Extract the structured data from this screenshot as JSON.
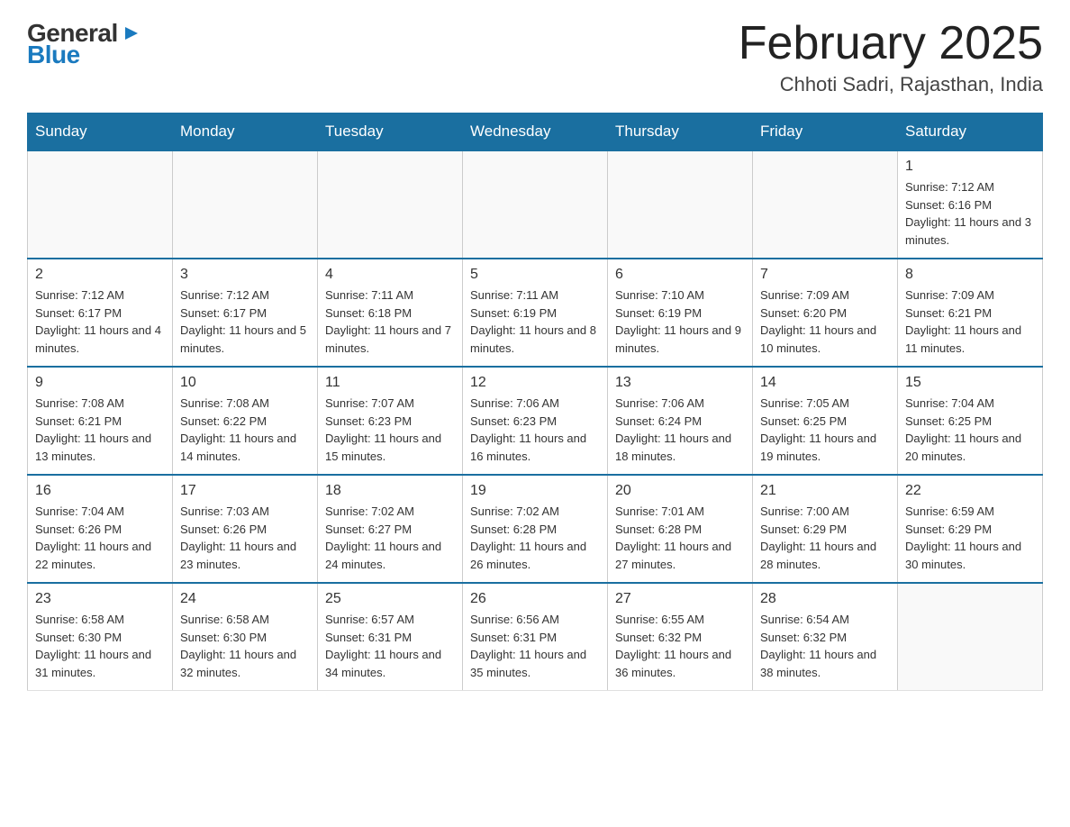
{
  "logo": {
    "general": "General",
    "blue": "Blue",
    "arrow": "▶"
  },
  "title": "February 2025",
  "location": "Chhoti Sadri, Rajasthan, India",
  "days_of_week": [
    "Sunday",
    "Monday",
    "Tuesday",
    "Wednesday",
    "Thursday",
    "Friday",
    "Saturday"
  ],
  "weeks": [
    [
      {
        "day": "",
        "info": ""
      },
      {
        "day": "",
        "info": ""
      },
      {
        "day": "",
        "info": ""
      },
      {
        "day": "",
        "info": ""
      },
      {
        "day": "",
        "info": ""
      },
      {
        "day": "",
        "info": ""
      },
      {
        "day": "1",
        "info": "Sunrise: 7:12 AM\nSunset: 6:16 PM\nDaylight: 11 hours\nand 3 minutes."
      }
    ],
    [
      {
        "day": "2",
        "info": "Sunrise: 7:12 AM\nSunset: 6:17 PM\nDaylight: 11 hours\nand 4 minutes."
      },
      {
        "day": "3",
        "info": "Sunrise: 7:12 AM\nSunset: 6:17 PM\nDaylight: 11 hours\nand 5 minutes."
      },
      {
        "day": "4",
        "info": "Sunrise: 7:11 AM\nSunset: 6:18 PM\nDaylight: 11 hours\nand 7 minutes."
      },
      {
        "day": "5",
        "info": "Sunrise: 7:11 AM\nSunset: 6:19 PM\nDaylight: 11 hours\nand 8 minutes."
      },
      {
        "day": "6",
        "info": "Sunrise: 7:10 AM\nSunset: 6:19 PM\nDaylight: 11 hours\nand 9 minutes."
      },
      {
        "day": "7",
        "info": "Sunrise: 7:09 AM\nSunset: 6:20 PM\nDaylight: 11 hours\nand 10 minutes."
      },
      {
        "day": "8",
        "info": "Sunrise: 7:09 AM\nSunset: 6:21 PM\nDaylight: 11 hours\nand 11 minutes."
      }
    ],
    [
      {
        "day": "9",
        "info": "Sunrise: 7:08 AM\nSunset: 6:21 PM\nDaylight: 11 hours\nand 13 minutes."
      },
      {
        "day": "10",
        "info": "Sunrise: 7:08 AM\nSunset: 6:22 PM\nDaylight: 11 hours\nand 14 minutes."
      },
      {
        "day": "11",
        "info": "Sunrise: 7:07 AM\nSunset: 6:23 PM\nDaylight: 11 hours\nand 15 minutes."
      },
      {
        "day": "12",
        "info": "Sunrise: 7:06 AM\nSunset: 6:23 PM\nDaylight: 11 hours\nand 16 minutes."
      },
      {
        "day": "13",
        "info": "Sunrise: 7:06 AM\nSunset: 6:24 PM\nDaylight: 11 hours\nand 18 minutes."
      },
      {
        "day": "14",
        "info": "Sunrise: 7:05 AM\nSunset: 6:25 PM\nDaylight: 11 hours\nand 19 minutes."
      },
      {
        "day": "15",
        "info": "Sunrise: 7:04 AM\nSunset: 6:25 PM\nDaylight: 11 hours\nand 20 minutes."
      }
    ],
    [
      {
        "day": "16",
        "info": "Sunrise: 7:04 AM\nSunset: 6:26 PM\nDaylight: 11 hours\nand 22 minutes."
      },
      {
        "day": "17",
        "info": "Sunrise: 7:03 AM\nSunset: 6:26 PM\nDaylight: 11 hours\nand 23 minutes."
      },
      {
        "day": "18",
        "info": "Sunrise: 7:02 AM\nSunset: 6:27 PM\nDaylight: 11 hours\nand 24 minutes."
      },
      {
        "day": "19",
        "info": "Sunrise: 7:02 AM\nSunset: 6:28 PM\nDaylight: 11 hours\nand 26 minutes."
      },
      {
        "day": "20",
        "info": "Sunrise: 7:01 AM\nSunset: 6:28 PM\nDaylight: 11 hours\nand 27 minutes."
      },
      {
        "day": "21",
        "info": "Sunrise: 7:00 AM\nSunset: 6:29 PM\nDaylight: 11 hours\nand 28 minutes."
      },
      {
        "day": "22",
        "info": "Sunrise: 6:59 AM\nSunset: 6:29 PM\nDaylight: 11 hours\nand 30 minutes."
      }
    ],
    [
      {
        "day": "23",
        "info": "Sunrise: 6:58 AM\nSunset: 6:30 PM\nDaylight: 11 hours\nand 31 minutes."
      },
      {
        "day": "24",
        "info": "Sunrise: 6:58 AM\nSunset: 6:30 PM\nDaylight: 11 hours\nand 32 minutes."
      },
      {
        "day": "25",
        "info": "Sunrise: 6:57 AM\nSunset: 6:31 PM\nDaylight: 11 hours\nand 34 minutes."
      },
      {
        "day": "26",
        "info": "Sunrise: 6:56 AM\nSunset: 6:31 PM\nDaylight: 11 hours\nand 35 minutes."
      },
      {
        "day": "27",
        "info": "Sunrise: 6:55 AM\nSunset: 6:32 PM\nDaylight: 11 hours\nand 36 minutes."
      },
      {
        "day": "28",
        "info": "Sunrise: 6:54 AM\nSunset: 6:32 PM\nDaylight: 11 hours\nand 38 minutes."
      },
      {
        "day": "",
        "info": ""
      }
    ]
  ]
}
